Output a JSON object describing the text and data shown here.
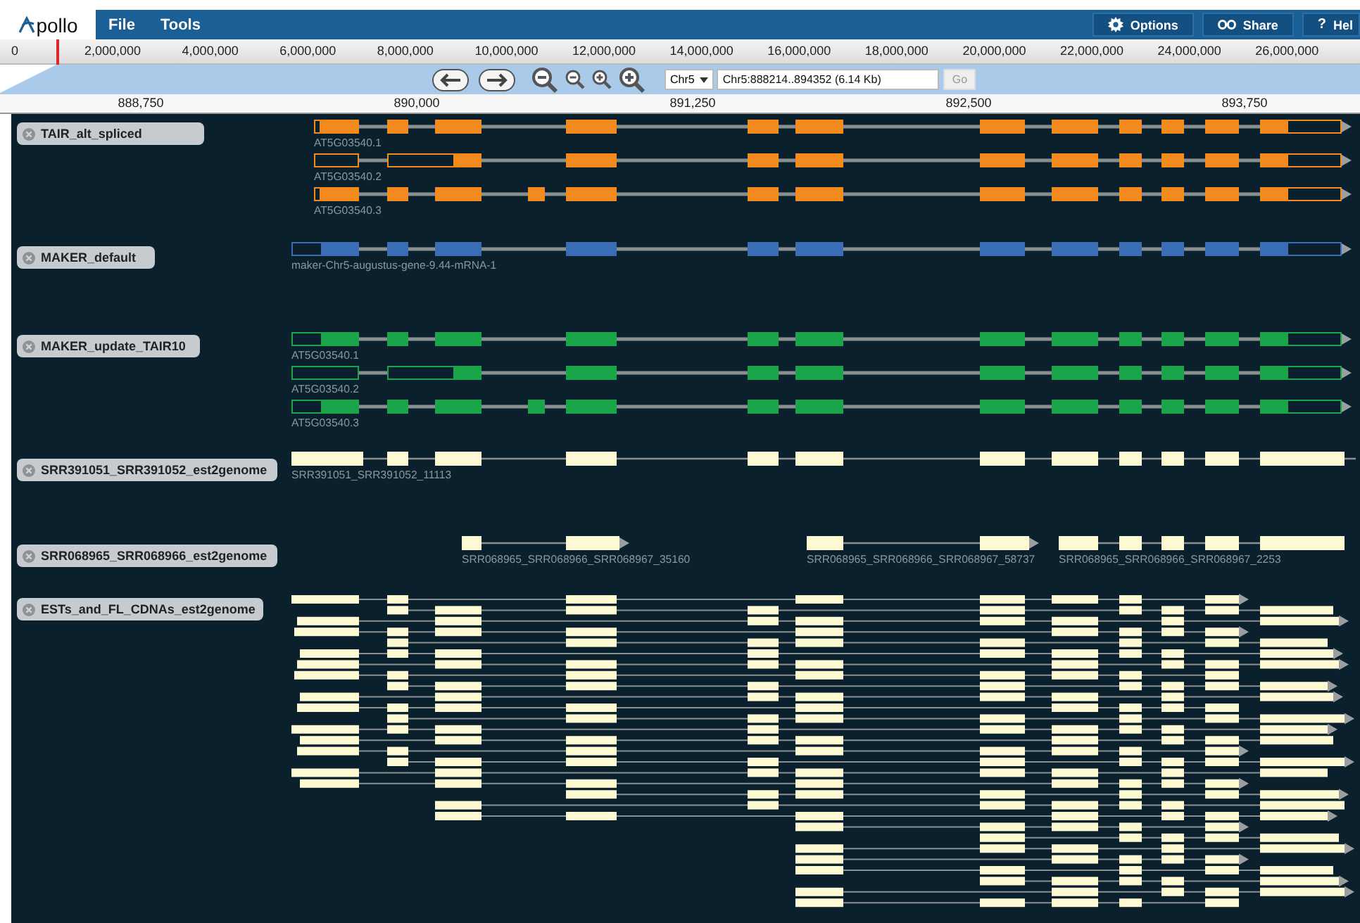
{
  "header": {
    "logo": "pollo",
    "menus": [
      "File",
      "Tools"
    ],
    "buttons": [
      {
        "kind": "options",
        "label": "Options"
      },
      {
        "kind": "share",
        "label": "Share"
      },
      {
        "kind": "help",
        "icon": "?",
        "label": "Hel"
      }
    ]
  },
  "overview": {
    "ticks": [
      "0",
      "2,000,000",
      "4,000,000",
      "6,000,000",
      "8,000,000",
      "10,000,000",
      "12,000,000",
      "14,000,000",
      "16,000,000",
      "18,000,000",
      "20,000,000",
      "22,000,000",
      "24,000,000",
      "26,000,000"
    ]
  },
  "navigation": {
    "chromosome": "Chr5",
    "location": "Chr5:888214..894352 (6.14 Kb)",
    "go": "Go"
  },
  "detail_ruler": {
    "ticks": [
      "888,750",
      "890,000",
      "891,250",
      "892,500",
      "893,750"
    ]
  },
  "tracks": [
    {
      "name": "TAIR_alt_spliced",
      "kind": "gene",
      "color": "#f28a1e",
      "features": [
        "AT5G03540.1",
        "AT5G03540.2",
        "AT5G03540.3"
      ]
    },
    {
      "name": "MAKER_default",
      "kind": "gene",
      "color": "#3a6db5",
      "features": [
        "maker-Chr5-augustus-gene-9.44-mRNA-1"
      ]
    },
    {
      "name": "MAKER_update_TAIR10",
      "kind": "gene",
      "color": "#1aa54a",
      "features": [
        "AT5G03540.1",
        "AT5G03540.2",
        "AT5G03540.3"
      ]
    },
    {
      "name": "SRR391051_SRR391052_est2genome",
      "kind": "est",
      "color": "#fdf9d3",
      "features": [
        "SRR391051_SRR391052_11113"
      ]
    },
    {
      "name": "SRR068965_SRR068966_est2genome",
      "kind": "est",
      "color": "#fdf9d3",
      "features": [
        "SRR068965_SRR068966_SRR068967_35160",
        "SRR068965_SRR068966_SRR068967_58737",
        "SRR068965_SRR068966_SRR068967_2253"
      ]
    },
    {
      "name": "ESTs_and_FL_CDNAs_est2genome",
      "kind": "pileup",
      "color": "#fdf9d3"
    }
  ]
}
